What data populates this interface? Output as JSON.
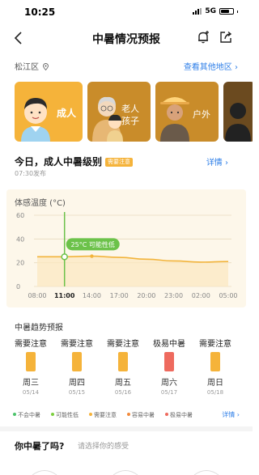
{
  "status": {
    "time": "10:25",
    "network": "5G"
  },
  "nav": {
    "title": "中暑情况预报",
    "icons": [
      "back-arrow-icon",
      "bell-plus-icon",
      "share-icon"
    ]
  },
  "location": {
    "name": "松江区",
    "link": "查看其他地区",
    "icon": "location-pin-icon"
  },
  "groups": [
    {
      "label": "成人",
      "selected": true,
      "color": "#f5b33a"
    },
    {
      "label_line1": "老人",
      "label_line2": "孩子",
      "selected": false,
      "color": "#c98c2a"
    },
    {
      "label": "户外",
      "selected": false,
      "color": "#c98c2a"
    },
    {
      "label": "",
      "selected": false,
      "color": "#6b4a1f"
    }
  ],
  "level": {
    "title": "今日，成人中暑级别",
    "badge": "需要注意",
    "detail_link": "详情",
    "publish_time": "07:30发布"
  },
  "temp_chart": {
    "label": "体感温度 (°C)",
    "tooltip": "25°C 可能性低",
    "current_time": "11:00"
  },
  "chart_data": {
    "type": "line",
    "title": "体感温度 (°C)",
    "x": [
      "08:00",
      "11:00",
      "14:00",
      "17:00",
      "20:00",
      "23:00",
      "02:00",
      "05:00"
    ],
    "y_ticks": [
      "0",
      "20",
      "40",
      "60"
    ],
    "ylim": [
      0,
      60
    ],
    "series": [
      {
        "values": [
          25,
          25,
          25.5,
          24.5,
          23,
          21.5,
          20.5,
          21
        ]
      }
    ],
    "highlight": {
      "x": "11:00",
      "y": 25,
      "label": "25°C 可能性低"
    },
    "grid": true
  },
  "trend": {
    "title": "中暑趋势预报",
    "days": [
      {
        "level": "需要注意",
        "week": "周三",
        "date": "05/14",
        "color": "#f5b33a"
      },
      {
        "level": "需要注意",
        "week": "周四",
        "date": "05/15",
        "color": "#f5b33a"
      },
      {
        "level": "需要注意",
        "week": "周五",
        "date": "05/16",
        "color": "#f5b33a"
      },
      {
        "level": "极易中暑",
        "week": "周六",
        "date": "05/17",
        "color": "#ee6a5e"
      },
      {
        "level": "需要注意",
        "week": "周日",
        "date": "05/18",
        "color": "#f5b33a"
      }
    ]
  },
  "legend": {
    "items": [
      {
        "label": "不会中暑",
        "color": "#4cc36b"
      },
      {
        "label": "可能性低",
        "color": "#7ccf3f"
      },
      {
        "label": "需要注意",
        "color": "#f5b33a"
      },
      {
        "label": "容易中暑",
        "color": "#f28a3c"
      },
      {
        "label": "极易中暑",
        "color": "#ee6a5e"
      }
    ],
    "detail_link": "详情"
  },
  "question": {
    "title": "你中暑了吗?",
    "hint": "请选择你的感受"
  }
}
